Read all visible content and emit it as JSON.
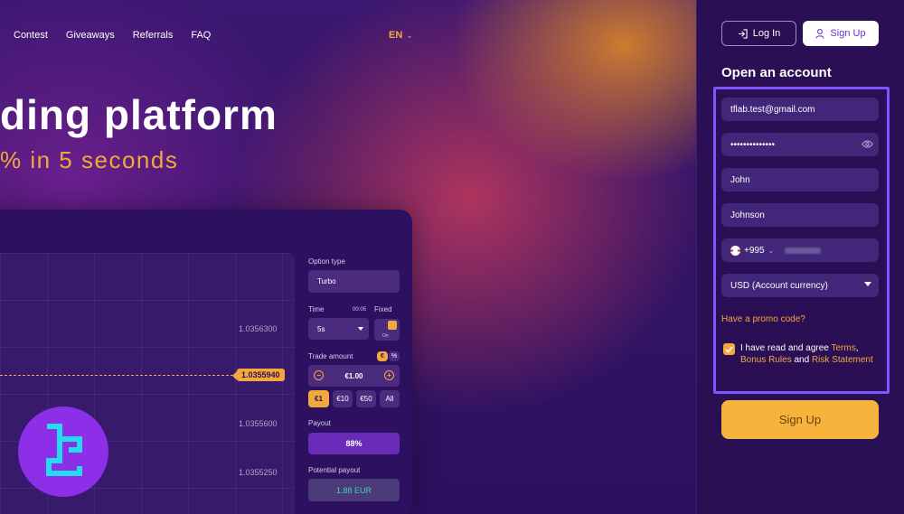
{
  "nav": {
    "items": [
      "Contest",
      "Giveaways",
      "Referrals",
      "FAQ"
    ],
    "language": "EN"
  },
  "hero": {
    "title": "ding platform",
    "subtitle": "% in 5 seconds"
  },
  "trade_panel": {
    "option_type_label": "Option type",
    "option_type_value": "Turbo",
    "time_label": "Time",
    "time_countdown": "00:05",
    "time_mode": "Fixed",
    "time_value": "5s",
    "toggle_state": "On",
    "trade_amount_label": "Trade amount",
    "currency_euro": "€",
    "currency_percent": "%",
    "amount_value": "€1.00",
    "minus": "−",
    "plus": "+",
    "quick_amounts": [
      "€1",
      "€10",
      "€50",
      "All"
    ],
    "payout_label": "Payout",
    "payout_value": "88%",
    "potential_label": "Potential payout",
    "potential_value": "1.88 EUR",
    "prices": [
      "1.0356300",
      "1.0355600",
      "1.0355250"
    ],
    "current_price": "1.0355940"
  },
  "header": {
    "login_label": "Log In",
    "signup_label": "Sign Up"
  },
  "form": {
    "title": "Open an account",
    "email_value": "tflab.test@gmail.com",
    "password_value": "••••••••••••••",
    "first_name_value": "John",
    "last_name_value": "Johnson",
    "phone_code": "+995",
    "currency_value": "USD (Account currency)",
    "promo_label": "Have a promo code?",
    "agree_prefix": "I have read and agree",
    "terms_link": "Terms",
    "comma": ",",
    "bonus_link": "Bonus Rules",
    "and_text": "and",
    "risk_link": "Risk Statement",
    "submit_label": "Sign Up"
  },
  "colors": {
    "accent": "#f2a93b",
    "highlight": "#7a56ff",
    "panel": "#2e1060"
  }
}
